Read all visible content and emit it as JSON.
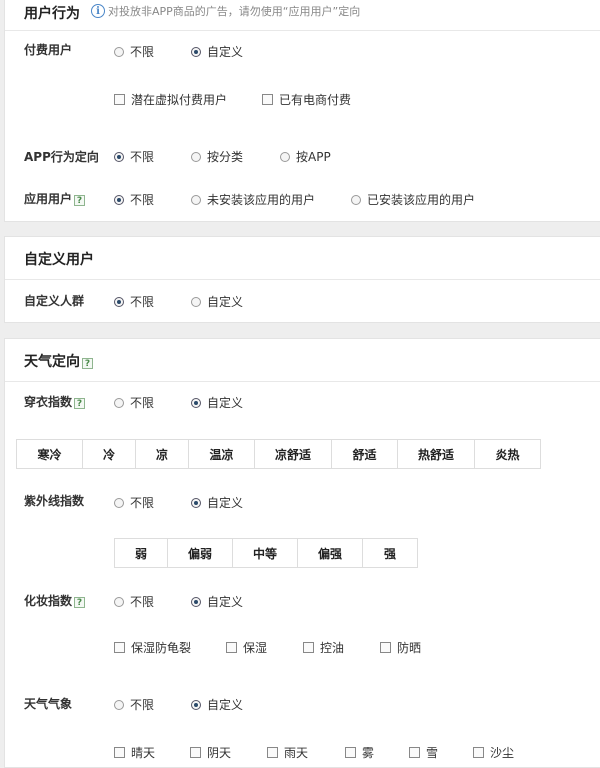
{
  "user_behavior": {
    "title": "用户行为",
    "hint": "对投放非APP商品的广告，请勿使用“应用用户”定向",
    "paying": {
      "label": "付费用户",
      "opt1": "不限",
      "opt2": "自定义",
      "cb1": "潜在虚拟付费用户",
      "cb2": "已有电商付费"
    },
    "app_behavior": {
      "label": "APP行为定向",
      "opt1": "不限",
      "opt2": "按分类",
      "opt3": "按APP"
    },
    "app_users": {
      "label": "应用用户",
      "opt1": "不限",
      "opt2": "未安装该应用的用户",
      "opt3": "已安装该应用的用户"
    }
  },
  "custom_users": {
    "title": "自定义用户",
    "crowd": {
      "label": "自定义人群",
      "opt1": "不限",
      "opt2": "自定义"
    }
  },
  "weather": {
    "title": "天气定向",
    "help": "?",
    "clothing": {
      "label": "穿衣指数",
      "opt1": "不限",
      "opt2": "自定义",
      "levels": [
        "寒冷",
        "冷",
        "凉",
        "温凉",
        "凉舒适",
        "舒适",
        "热舒适",
        "炎热"
      ]
    },
    "uv": {
      "label": "紫外线指数",
      "opt1": "不限",
      "opt2": "自定义",
      "levels": [
        "弱",
        "偏弱",
        "中等",
        "偏强",
        "强"
      ]
    },
    "makeup": {
      "label": "化妆指数",
      "opt1": "不限",
      "opt2": "自定义",
      "cb1": "保湿防龟裂",
      "cb2": "保湿",
      "cb3": "控油",
      "cb4": "防晒"
    },
    "phenomena": {
      "label": "天气气象",
      "opt1": "不限",
      "opt2": "自定义",
      "cb1": "晴天",
      "cb2": "阴天",
      "cb3": "雨天",
      "cb4": "雾",
      "cb5": "雪",
      "cb6": "沙尘"
    }
  }
}
